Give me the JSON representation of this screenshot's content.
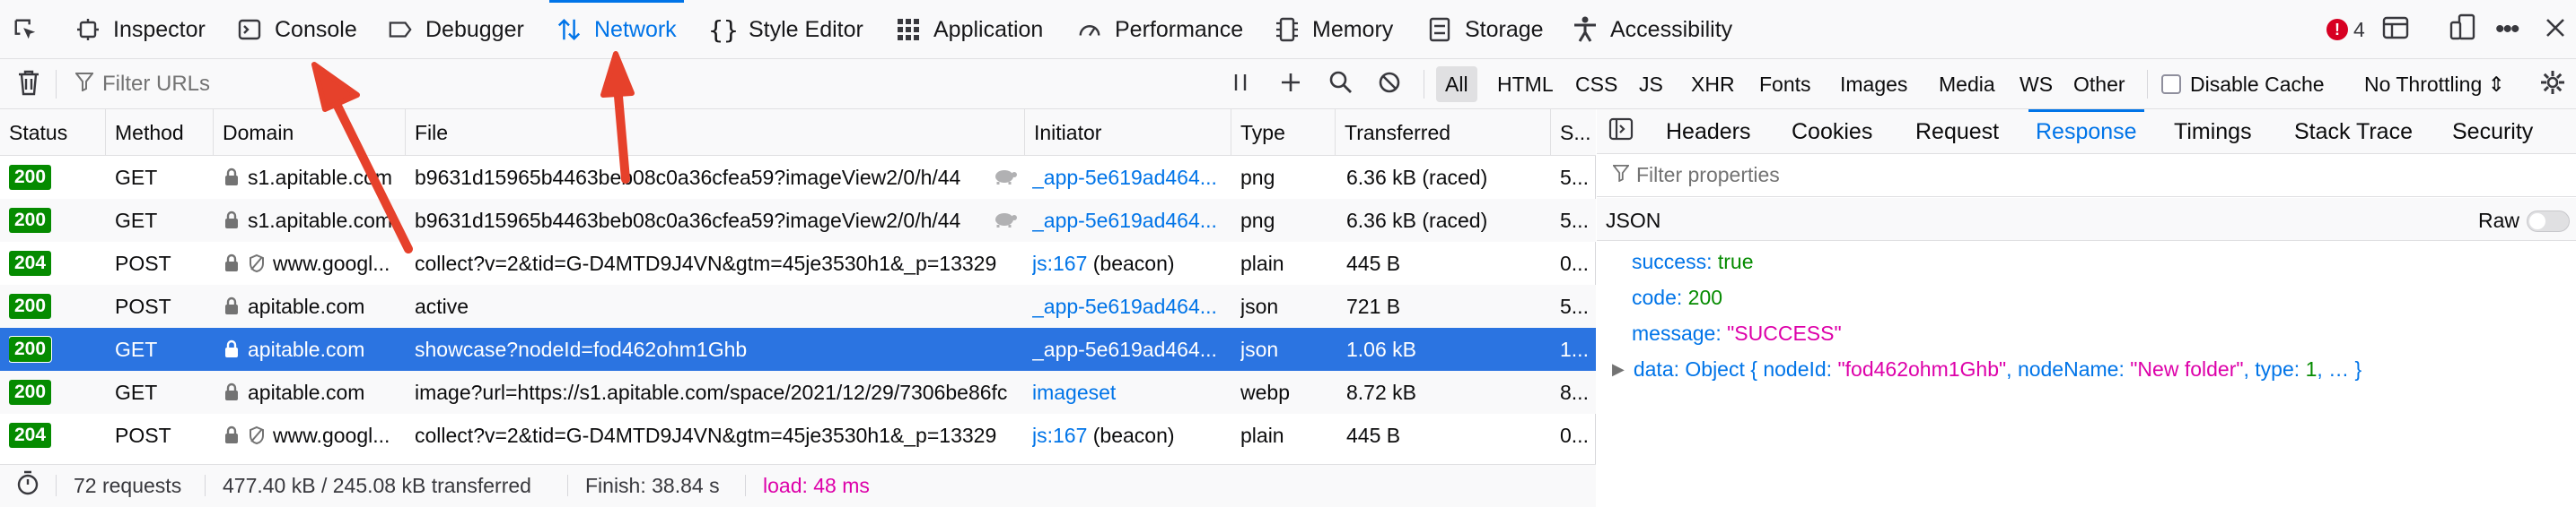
{
  "devtools": {
    "tabs": [
      {
        "label": "Inspector",
        "icon": "inspector-icon"
      },
      {
        "label": "Console",
        "icon": "console-icon"
      },
      {
        "label": "Debugger",
        "icon": "debugger-icon"
      },
      {
        "label": "Network",
        "icon": "network-icon",
        "selected": true
      },
      {
        "label": "Style Editor",
        "icon": "style-editor-icon"
      },
      {
        "label": "Application",
        "icon": "application-icon"
      },
      {
        "label": "Performance",
        "icon": "performance-icon"
      },
      {
        "label": "Memory",
        "icon": "memory-icon"
      },
      {
        "label": "Storage",
        "icon": "storage-icon"
      },
      {
        "label": "Accessibility",
        "icon": "accessibility-icon"
      }
    ],
    "error_count": "4"
  },
  "toolbar": {
    "filter_placeholder": "Filter URLs",
    "types": [
      "All",
      "HTML",
      "CSS",
      "JS",
      "XHR",
      "Fonts",
      "Images",
      "Media",
      "WS",
      "Other"
    ],
    "active_type": "All",
    "disable_cache_label": "Disable Cache",
    "throttling_label": "No Throttling ⇕"
  },
  "columns": [
    "Status",
    "Method",
    "Domain",
    "File",
    "Initiator",
    "Type",
    "Transferred",
    "S..."
  ],
  "requests": [
    {
      "status": "200",
      "method": "GET",
      "domain": "s1.apitable.com",
      "file": "b9631d15965b4463beb08c0a36cfea59?imageView2/0/h/44",
      "initiator": "_app-5e619ad464...",
      "type": "png",
      "transferred": "6.36 kB (raced)",
      "size": "5..."
    },
    {
      "status": "200",
      "method": "GET",
      "domain": "s1.apitable.com",
      "file": "b9631d15965b4463beb08c0a36cfea59?imageView2/0/h/44",
      "initiator": "_app-5e619ad464...",
      "type": "png",
      "transferred": "6.36 kB (raced)",
      "size": "5..."
    },
    {
      "status": "204",
      "method": "POST",
      "domain": "www.googl...",
      "file": "collect?v=2&tid=G-D4MTD9J4VN&gtm=45je3530h1&_p=13329",
      "initiator": "js:167",
      "initiator_suffix": " (beacon)",
      "type": "plain",
      "transferred": "445 B",
      "size": "0..."
    },
    {
      "status": "200",
      "method": "POST",
      "domain": "apitable.com",
      "file": "active",
      "initiator": "_app-5e619ad464...",
      "type": "json",
      "transferred": "721 B",
      "size": "5..."
    },
    {
      "status": "200",
      "method": "GET",
      "domain": "apitable.com",
      "file": "showcase?nodeId=fod462ohm1Ghb",
      "initiator": "_app-5e619ad464...",
      "type": "json",
      "transferred": "1.06 kB",
      "size": "1..."
    },
    {
      "status": "200",
      "method": "GET",
      "domain": "apitable.com",
      "file": "image?url=https://s1.apitable.com/space/2021/12/29/7306be86fc",
      "initiator": "imageset",
      "type": "webp",
      "transferred": "8.72 kB",
      "size": "8..."
    },
    {
      "status": "204",
      "method": "POST",
      "domain": "www.googl...",
      "file": "collect?v=2&tid=G-D4MTD9J4VN&gtm=45je3530h1&_p=13329",
      "initiator": "js:167",
      "initiator_suffix": " (beacon)",
      "type": "plain",
      "transferred": "445 B",
      "size": "0..."
    }
  ],
  "statusbar": {
    "requests": "72 requests",
    "transferred": "477.40 kB / 245.08 kB transferred",
    "finish": "Finish: 38.84 s",
    "load": "load: 48 ms"
  },
  "details": {
    "tabs": [
      "Headers",
      "Cookies",
      "Request",
      "Response",
      "Timings",
      "Stack Trace",
      "Security"
    ],
    "selected_tab": "Response",
    "filter_placeholder": "Filter properties",
    "section_label": "JSON",
    "raw_label": "Raw",
    "json": {
      "success_key": "success:",
      "success_val": "true",
      "code_key": "code:",
      "code_val": "200",
      "message_key": "message:",
      "message_val": "\"SUCCESS\"",
      "data_key": "data:",
      "data_prefix": "Object {",
      "data_k1": "nodeId:",
      "data_v1": "\"fod462ohm1Ghb\"",
      "data_k2": "nodeName:",
      "data_v2": "\"New folder\"",
      "data_k3": "type:",
      "data_v3": "1",
      "data_suffix": ", … }"
    }
  },
  "colors": {
    "accent": "#0074e8",
    "selected_row": "#2b74e1",
    "ok_badge": "#058b00",
    "load": "#dd00a9",
    "annotation_arrow": "#e6412b"
  }
}
